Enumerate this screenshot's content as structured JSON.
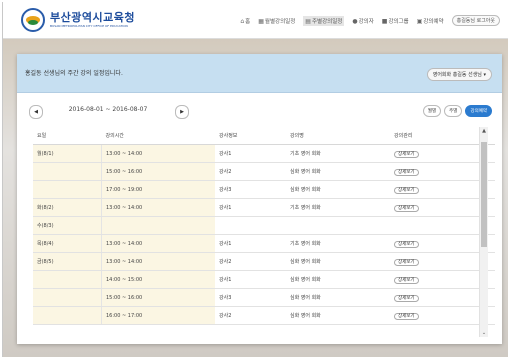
{
  "header": {
    "logo_title": "부산광역시교육청",
    "logo_subtitle": "BUSAN METROPOLITAN CITY OFFICE OF EDUCATION",
    "nav": [
      {
        "icon": "home-icon",
        "glyph": "⌂",
        "label": "홈"
      },
      {
        "icon": "calendar-icon",
        "glyph": "▦",
        "label": "월별강의일정"
      },
      {
        "icon": "calendar-week-icon",
        "glyph": "▤",
        "label": "주별강의일정"
      },
      {
        "icon": "user-icon",
        "glyph": "●",
        "label": "강의자"
      },
      {
        "icon": "folder-icon",
        "glyph": "■",
        "label": "강의그룹"
      },
      {
        "icon": "booking-icon",
        "glyph": "▣",
        "label": "강의예약"
      }
    ],
    "logout_label": "홍길동님 로그아웃"
  },
  "panel": {
    "title": "홍길동 선생님의 주간 강의 일정입니다.",
    "teacher_select": "영어회화 홍길동 선생님 ▾"
  },
  "date_nav": {
    "prev": "◀",
    "range": "2016-08-01 ~ 2016-08-07",
    "next": "▶"
  },
  "view_buttons": [
    {
      "label": "월별",
      "active": false
    },
    {
      "label": "주별",
      "active": false
    },
    {
      "label": "강의예약",
      "active": true
    }
  ],
  "table": {
    "headers": [
      "요일",
      "강의시간",
      "강사정보",
      "강의명",
      "강의관리"
    ],
    "rows": [
      {
        "day": "월(8/1)",
        "time": "13:00 ~ 14:00",
        "instructor": "강사1",
        "lecture": "기초 영어 회화",
        "action": "상세보기"
      },
      {
        "day": "",
        "time": "15:00 ~ 16:00",
        "instructor": "강사2",
        "lecture": "심화 영어 회화",
        "action": "상세보기"
      },
      {
        "day": "",
        "time": "17:00 ~ 19:00",
        "instructor": "강사3",
        "lecture": "심화 영어 회화",
        "action": "상세보기"
      },
      {
        "day": "화(8/2)",
        "time": "13:00 ~ 14:00",
        "instructor": "강사1",
        "lecture": "기초 영어 회화",
        "action": "상세보기"
      },
      {
        "day": "수(8/3)",
        "time": "",
        "instructor": "",
        "lecture": "",
        "action": ""
      },
      {
        "day": "목(8/4)",
        "time": "13:00 ~ 14:00",
        "instructor": "강사1",
        "lecture": "기초 영어 회화",
        "action": "상세보기"
      },
      {
        "day": "금(8/5)",
        "time": "13:00 ~ 14:00",
        "instructor": "강사2",
        "lecture": "심화 영어 회화",
        "action": "상세보기"
      },
      {
        "day": "",
        "time": "14:00 ~ 15:00",
        "instructor": "강사1",
        "lecture": "심화 영어 회화",
        "action": "상세보기"
      },
      {
        "day": "",
        "time": "15:00 ~ 16:00",
        "instructor": "강사3",
        "lecture": "심화 영어 회화",
        "action": "상세보기"
      },
      {
        "day": "",
        "time": "16:00 ~ 17:00",
        "instructor": "강사2",
        "lecture": "심화 영어 회화",
        "action": "상세보기"
      }
    ]
  },
  "scrollbar": {
    "up": "▲",
    "down": "⌄"
  }
}
